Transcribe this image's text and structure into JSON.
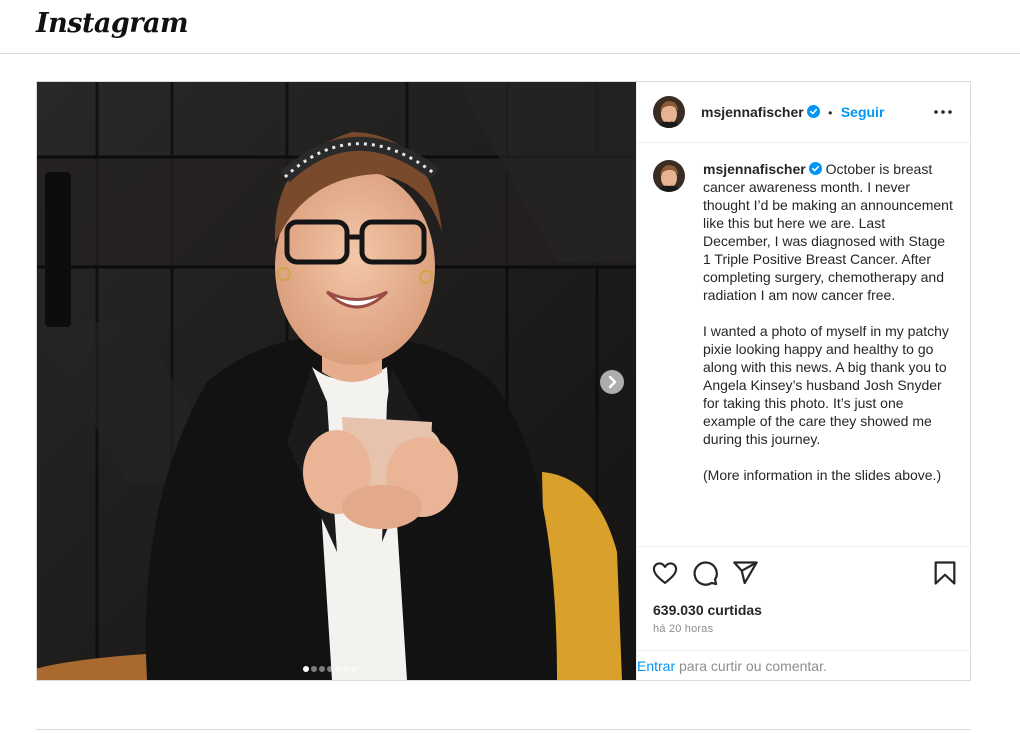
{
  "header": {
    "logo_text": "Instagram"
  },
  "post": {
    "author": {
      "username": "msjennafischer",
      "verified": true
    },
    "follow_separator": "•",
    "follow_label": "Seguir",
    "more_options_icon": "more-horizontal-icon",
    "caption": {
      "username": "msjennafischer",
      "paragraphs": [
        "October is breast cancer awareness month. I never thought I’d be making an announcement like this but here we are. Last December, I was diagnosed with Stage 1 Triple Positive Breast Cancer. After completing surgery, chemotherapy and radiation I am now cancer free.",
        "I wanted a photo of myself in my patchy pixie looking happy and healthy to go along with this news. A big thank you to Angela Kinsey’s husband Josh Snyder for taking this photo. It’s just one example of the care they showed me during this journey.",
        "(More information in the slides above.)"
      ]
    },
    "actions": {
      "like_icon": "heart-icon",
      "comment_icon": "comment-icon",
      "share_icon": "send-icon",
      "save_icon": "bookmark-icon"
    },
    "likes_text": "639.030 curtidas",
    "time_text": "há 20 horas",
    "login": {
      "link_text": "Entrar",
      "rest_text": " para curtir ou comentar."
    },
    "carousel": {
      "slide_count": 7,
      "active_index": 0,
      "next_icon": "chevron-right-icon"
    }
  },
  "colors": {
    "accent": "#0095f6",
    "border": "#dbdbdb",
    "muted": "#8e8e8e"
  }
}
